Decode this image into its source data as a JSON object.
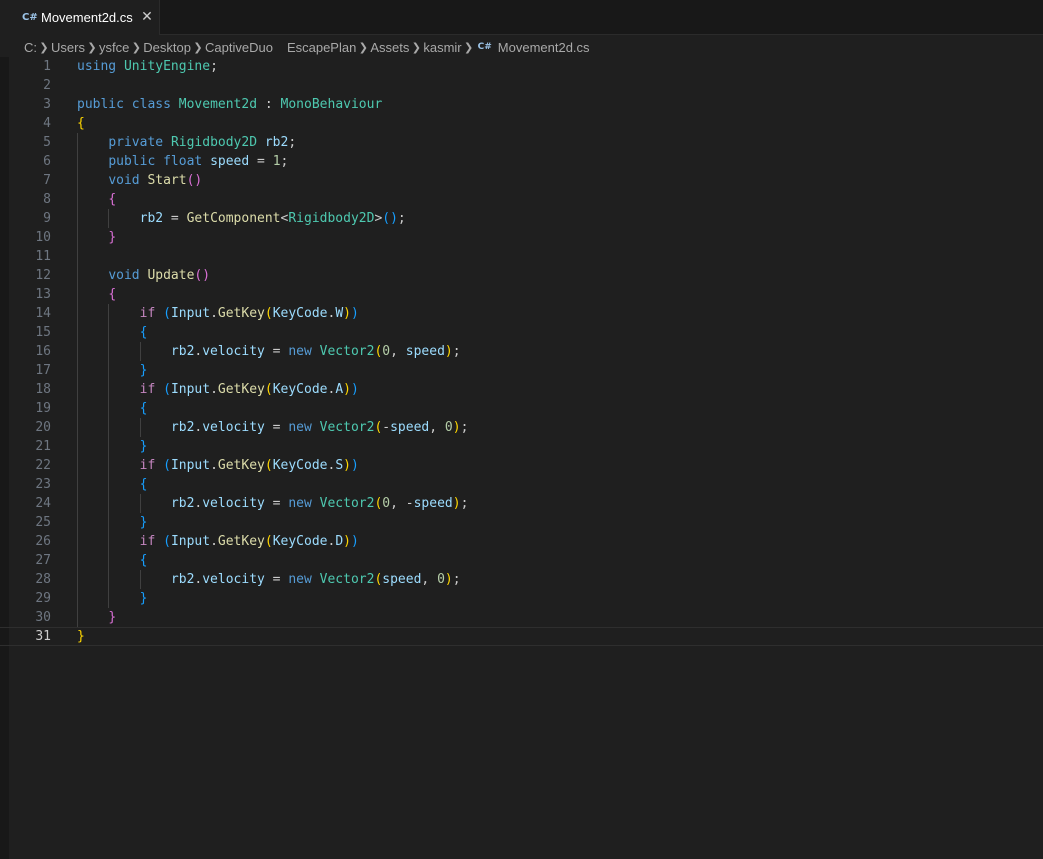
{
  "tab": {
    "icon": "C#",
    "filename": "Movement2d.cs",
    "close_symbol": "✕"
  },
  "breadcrumb": {
    "items": [
      "C:",
      "Users",
      "ysfce",
      "Desktop",
      "CaptiveDuo",
      "EscapePlan",
      "Assets",
      "kasmir"
    ],
    "file_icon": "C#",
    "file": "Movement2d.cs"
  },
  "editor": {
    "active_line": 31,
    "lines": [
      {
        "n": "1",
        "tokens": [
          [
            "kw",
            "using"
          ],
          [
            "t",
            " "
          ],
          [
            "ty",
            "UnityEngine"
          ],
          [
            "t",
            ";"
          ]
        ]
      },
      {
        "n": "2",
        "tokens": []
      },
      {
        "n": "3",
        "tokens": [
          [
            "kw",
            "public"
          ],
          [
            "t",
            " "
          ],
          [
            "kw",
            "class"
          ],
          [
            "t",
            " "
          ],
          [
            "ty",
            "Movement2d"
          ],
          [
            "t",
            " : "
          ],
          [
            "ty",
            "MonoBehaviour"
          ]
        ]
      },
      {
        "n": "4",
        "tokens": [
          [
            "b1",
            "{"
          ]
        ]
      },
      {
        "n": "5",
        "tokens": [
          [
            "t",
            "    "
          ],
          [
            "kw",
            "private"
          ],
          [
            "t",
            " "
          ],
          [
            "ty",
            "Rigidbody2D"
          ],
          [
            "t",
            " "
          ],
          [
            "va",
            "rb2"
          ],
          [
            "t",
            ";"
          ]
        ]
      },
      {
        "n": "6",
        "tokens": [
          [
            "t",
            "    "
          ],
          [
            "kw",
            "public"
          ],
          [
            "t",
            " "
          ],
          [
            "kw",
            "float"
          ],
          [
            "t",
            " "
          ],
          [
            "va",
            "speed"
          ],
          [
            "t",
            " = "
          ],
          [
            "nm",
            "1"
          ],
          [
            "t",
            ";"
          ]
        ]
      },
      {
        "n": "7",
        "tokens": [
          [
            "t",
            "    "
          ],
          [
            "kw",
            "void"
          ],
          [
            "t",
            " "
          ],
          [
            "fn",
            "Start"
          ],
          [
            "b2",
            "()"
          ]
        ]
      },
      {
        "n": "8",
        "tokens": [
          [
            "t",
            "    "
          ],
          [
            "b2",
            "{"
          ]
        ]
      },
      {
        "n": "9",
        "tokens": [
          [
            "t",
            "        "
          ],
          [
            "va",
            "rb2"
          ],
          [
            "t",
            " = "
          ],
          [
            "fn",
            "GetComponent"
          ],
          [
            "t",
            "<"
          ],
          [
            "ty",
            "Rigidbody2D"
          ],
          [
            "t",
            ">"
          ],
          [
            "b3",
            "()"
          ],
          [
            "t",
            ";"
          ]
        ]
      },
      {
        "n": "10",
        "tokens": [
          [
            "t",
            "    "
          ],
          [
            "b2",
            "}"
          ]
        ]
      },
      {
        "n": "11",
        "tokens": []
      },
      {
        "n": "12",
        "tokens": [
          [
            "t",
            "    "
          ],
          [
            "kw",
            "void"
          ],
          [
            "t",
            " "
          ],
          [
            "fn",
            "Update"
          ],
          [
            "b2",
            "()"
          ]
        ]
      },
      {
        "n": "13",
        "tokens": [
          [
            "t",
            "    "
          ],
          [
            "b2",
            "{"
          ]
        ]
      },
      {
        "n": "14",
        "tokens": [
          [
            "t",
            "        "
          ],
          [
            "kc",
            "if"
          ],
          [
            "t",
            " "
          ],
          [
            "b3",
            "("
          ],
          [
            "va",
            "Input"
          ],
          [
            "t",
            "."
          ],
          [
            "fn",
            "GetKey"
          ],
          [
            "b1",
            "("
          ],
          [
            "va",
            "KeyCode"
          ],
          [
            "t",
            "."
          ],
          [
            "va",
            "W"
          ],
          [
            "b1",
            ")"
          ],
          [
            "b3",
            ")"
          ]
        ]
      },
      {
        "n": "15",
        "tokens": [
          [
            "t",
            "        "
          ],
          [
            "b3",
            "{"
          ]
        ]
      },
      {
        "n": "16",
        "tokens": [
          [
            "t",
            "            "
          ],
          [
            "va",
            "rb2"
          ],
          [
            "t",
            "."
          ],
          [
            "va",
            "velocity"
          ],
          [
            "t",
            " = "
          ],
          [
            "kw",
            "new"
          ],
          [
            "t",
            " "
          ],
          [
            "ty",
            "Vector2"
          ],
          [
            "b1",
            "("
          ],
          [
            "nm",
            "0"
          ],
          [
            "t",
            ", "
          ],
          [
            "va",
            "speed"
          ],
          [
            "b1",
            ")"
          ],
          [
            "t",
            ";"
          ]
        ]
      },
      {
        "n": "17",
        "tokens": [
          [
            "t",
            "        "
          ],
          [
            "b3",
            "}"
          ]
        ]
      },
      {
        "n": "18",
        "tokens": [
          [
            "t",
            "        "
          ],
          [
            "kc",
            "if"
          ],
          [
            "t",
            " "
          ],
          [
            "b3",
            "("
          ],
          [
            "va",
            "Input"
          ],
          [
            "t",
            "."
          ],
          [
            "fn",
            "GetKey"
          ],
          [
            "b1",
            "("
          ],
          [
            "va",
            "KeyCode"
          ],
          [
            "t",
            "."
          ],
          [
            "va",
            "A"
          ],
          [
            "b1",
            ")"
          ],
          [
            "b3",
            ")"
          ]
        ]
      },
      {
        "n": "19",
        "tokens": [
          [
            "t",
            "        "
          ],
          [
            "b3",
            "{"
          ]
        ]
      },
      {
        "n": "20",
        "tokens": [
          [
            "t",
            "            "
          ],
          [
            "va",
            "rb2"
          ],
          [
            "t",
            "."
          ],
          [
            "va",
            "velocity"
          ],
          [
            "t",
            " = "
          ],
          [
            "kw",
            "new"
          ],
          [
            "t",
            " "
          ],
          [
            "ty",
            "Vector2"
          ],
          [
            "b1",
            "("
          ],
          [
            "t",
            "-"
          ],
          [
            "va",
            "speed"
          ],
          [
            "t",
            ", "
          ],
          [
            "nm",
            "0"
          ],
          [
            "b1",
            ")"
          ],
          [
            "t",
            ";"
          ]
        ]
      },
      {
        "n": "21",
        "tokens": [
          [
            "t",
            "        "
          ],
          [
            "b3",
            "}"
          ]
        ]
      },
      {
        "n": "22",
        "tokens": [
          [
            "t",
            "        "
          ],
          [
            "kc",
            "if"
          ],
          [
            "t",
            " "
          ],
          [
            "b3",
            "("
          ],
          [
            "va",
            "Input"
          ],
          [
            "t",
            "."
          ],
          [
            "fn",
            "GetKey"
          ],
          [
            "b1",
            "("
          ],
          [
            "va",
            "KeyCode"
          ],
          [
            "t",
            "."
          ],
          [
            "va",
            "S"
          ],
          [
            "b1",
            ")"
          ],
          [
            "b3",
            ")"
          ]
        ]
      },
      {
        "n": "23",
        "tokens": [
          [
            "t",
            "        "
          ],
          [
            "b3",
            "{"
          ]
        ]
      },
      {
        "n": "24",
        "tokens": [
          [
            "t",
            "            "
          ],
          [
            "va",
            "rb2"
          ],
          [
            "t",
            "."
          ],
          [
            "va",
            "velocity"
          ],
          [
            "t",
            " = "
          ],
          [
            "kw",
            "new"
          ],
          [
            "t",
            " "
          ],
          [
            "ty",
            "Vector2"
          ],
          [
            "b1",
            "("
          ],
          [
            "nm",
            "0"
          ],
          [
            "t",
            ", -"
          ],
          [
            "va",
            "speed"
          ],
          [
            "b1",
            ")"
          ],
          [
            "t",
            ";"
          ]
        ]
      },
      {
        "n": "25",
        "tokens": [
          [
            "t",
            "        "
          ],
          [
            "b3",
            "}"
          ]
        ]
      },
      {
        "n": "26",
        "tokens": [
          [
            "t",
            "        "
          ],
          [
            "kc",
            "if"
          ],
          [
            "t",
            " "
          ],
          [
            "b3",
            "("
          ],
          [
            "va",
            "Input"
          ],
          [
            "t",
            "."
          ],
          [
            "fn",
            "GetKey"
          ],
          [
            "b1",
            "("
          ],
          [
            "va",
            "KeyCode"
          ],
          [
            "t",
            "."
          ],
          [
            "va",
            "D"
          ],
          [
            "b1",
            ")"
          ],
          [
            "b3",
            ")"
          ]
        ]
      },
      {
        "n": "27",
        "tokens": [
          [
            "t",
            "        "
          ],
          [
            "b3",
            "{"
          ]
        ]
      },
      {
        "n": "28",
        "tokens": [
          [
            "t",
            "            "
          ],
          [
            "va",
            "rb2"
          ],
          [
            "t",
            "."
          ],
          [
            "va",
            "velocity"
          ],
          [
            "t",
            " = "
          ],
          [
            "kw",
            "new"
          ],
          [
            "t",
            " "
          ],
          [
            "ty",
            "Vector2"
          ],
          [
            "b1",
            "("
          ],
          [
            "va",
            "speed"
          ],
          [
            "t",
            ", "
          ],
          [
            "nm",
            "0"
          ],
          [
            "b1",
            ")"
          ],
          [
            "t",
            ";"
          ]
        ]
      },
      {
        "n": "29",
        "tokens": [
          [
            "t",
            "        "
          ],
          [
            "b3",
            "}"
          ]
        ]
      },
      {
        "n": "30",
        "tokens": [
          [
            "t",
            "    "
          ],
          [
            "b2",
            "}"
          ]
        ]
      },
      {
        "n": "31",
        "tokens": [
          [
            "b1",
            "}"
          ]
        ]
      }
    ]
  }
}
